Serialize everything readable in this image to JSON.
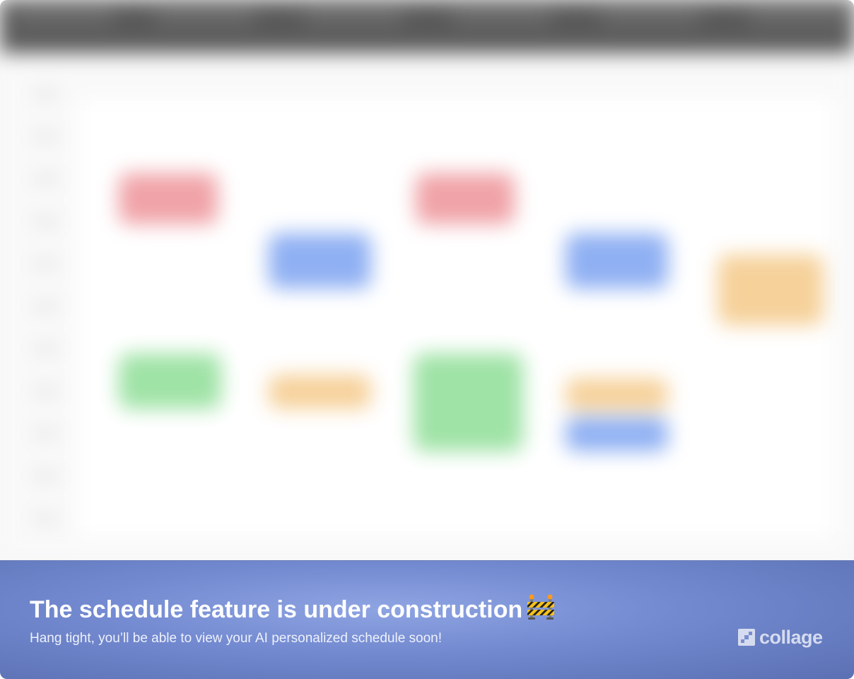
{
  "banner": {
    "title": "The schedule feature is under construction",
    "title_icon": "construction-barrier-icon",
    "subtitle": "Hang tight, you’ll be able to view your AI personalized schedule soon!"
  },
  "brand": {
    "icon": "collage-logo-icon",
    "name": "collage"
  },
  "colors": {
    "banner_gradient": [
      "#8ea4e2",
      "#7289d0",
      "#5b70b2"
    ],
    "event_red": "#f0a3a8",
    "event_blue": "#8fb0f3",
    "event_green": "#9fe3a6",
    "event_orange": "#f6d19a",
    "top_bar": "#5a5a5a"
  }
}
